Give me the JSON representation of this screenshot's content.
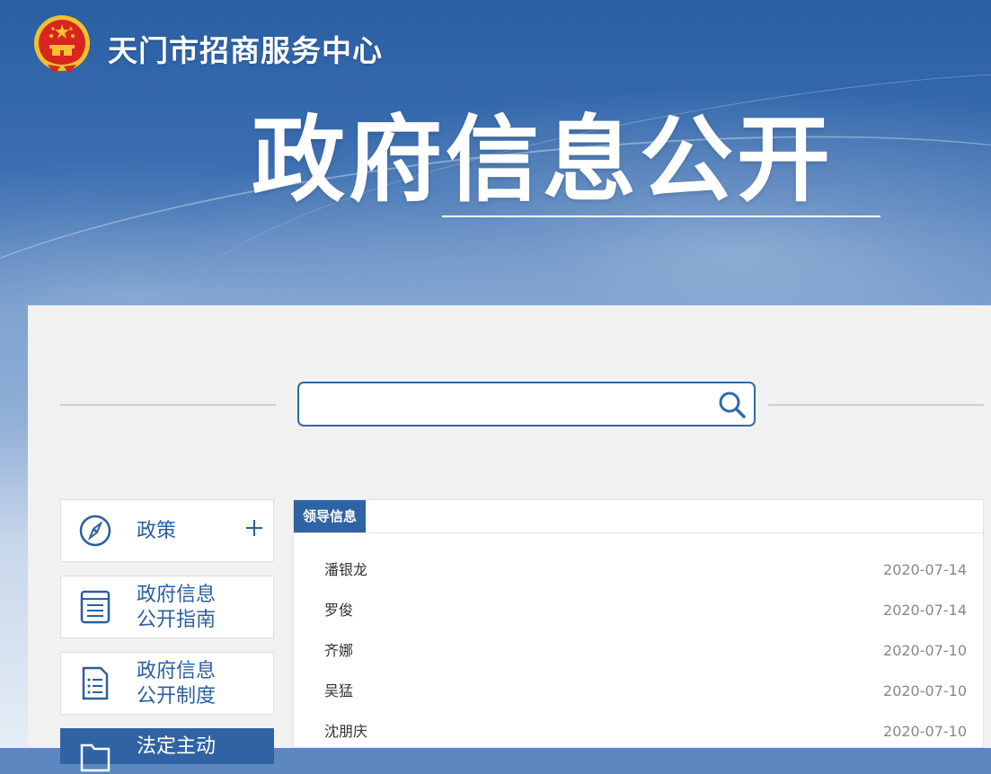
{
  "header": {
    "site_name": "天门市招商服务中心",
    "page_title": "政府信息公开"
  },
  "search": {
    "value": "",
    "placeholder": ""
  },
  "sidebar": {
    "items": [
      {
        "label_line1": "政策",
        "label_line2": "",
        "icon": "compass-icon",
        "expandable": true
      },
      {
        "label_line1": "政府信息",
        "label_line2": "公开指南",
        "icon": "list-document-icon",
        "expandable": false
      },
      {
        "label_line1": "政府信息",
        "label_line2": "公开制度",
        "icon": "checklist-document-icon",
        "expandable": false
      },
      {
        "label_line1": "法定主动",
        "label_line2": "",
        "icon": "folder-icon",
        "expandable": false
      }
    ]
  },
  "content": {
    "tab_label": "领导信息",
    "rows": [
      {
        "name": "潘银龙",
        "date": "2020-07-14"
      },
      {
        "name": "罗俊",
        "date": "2020-07-14"
      },
      {
        "name": "齐娜",
        "date": "2020-07-10"
      },
      {
        "name": "吴猛",
        "date": "2020-07-10"
      },
      {
        "name": "沈朋庆",
        "date": "2020-07-10"
      }
    ]
  },
  "colors": {
    "brand_blue": "#2f63a3",
    "banner_top": "#2a5fa4",
    "panel_bg": "#f1f1f1",
    "emblem_red": "#d7261e",
    "emblem_gold": "#f2c12e"
  }
}
